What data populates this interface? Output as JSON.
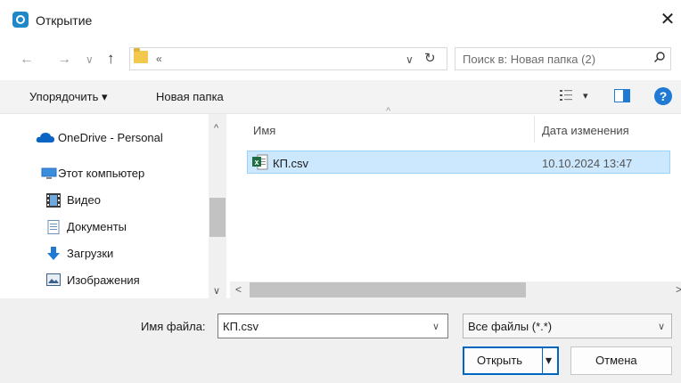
{
  "window": {
    "title": "Открытие",
    "close_glyph": "✕"
  },
  "address": {
    "back": "←",
    "forward": "→",
    "recent": "∨",
    "up": "↑",
    "crumb": "«",
    "dropdown": "∨",
    "refresh": "↻"
  },
  "search": {
    "placeholder": "Поиск в: Новая папка (2)"
  },
  "toolbar": {
    "organize": "Упорядочить ▾",
    "new_folder": "Новая папка",
    "view_arrow": "▾",
    "help": "?"
  },
  "nav": {
    "items": [
      {
        "label": "OneDrive - Personal",
        "icon": "onedrive-cloud-icon"
      },
      {
        "label": "Этот компьютер",
        "icon": "computer-icon"
      },
      {
        "label": "Видео",
        "icon": "video-icon"
      },
      {
        "label": "Документы",
        "icon": "documents-icon"
      },
      {
        "label": "Загрузки",
        "icon": "downloads-icon"
      },
      {
        "label": "Изображения",
        "icon": "pictures-icon"
      }
    ],
    "scroll_up": "^",
    "scroll_down": "∨"
  },
  "files": {
    "columns": [
      "Имя",
      "Дата изменения"
    ],
    "sort_arrow": "^",
    "rows": [
      {
        "name": "КП.csv",
        "modified": "10.10.2024 13:47",
        "icon": "excel-csv-icon",
        "selected": true
      }
    ],
    "hscroll_left": "<",
    "hscroll_right": ">"
  },
  "bottom": {
    "filename_label": "Имя файла:",
    "filename_value": "КП.csv",
    "filename_dropdown": "∨",
    "filetype_value": "Все файлы (*.*)",
    "filetype_dropdown": "∨",
    "open_label": "Открыть",
    "open_split_arrow": "▾",
    "cancel_label": "Отмена"
  },
  "colors": {
    "accent": "#0067c0",
    "selection": "#cce8ff",
    "excel_green": "#1d6f42",
    "folder": "#f2c94c"
  }
}
